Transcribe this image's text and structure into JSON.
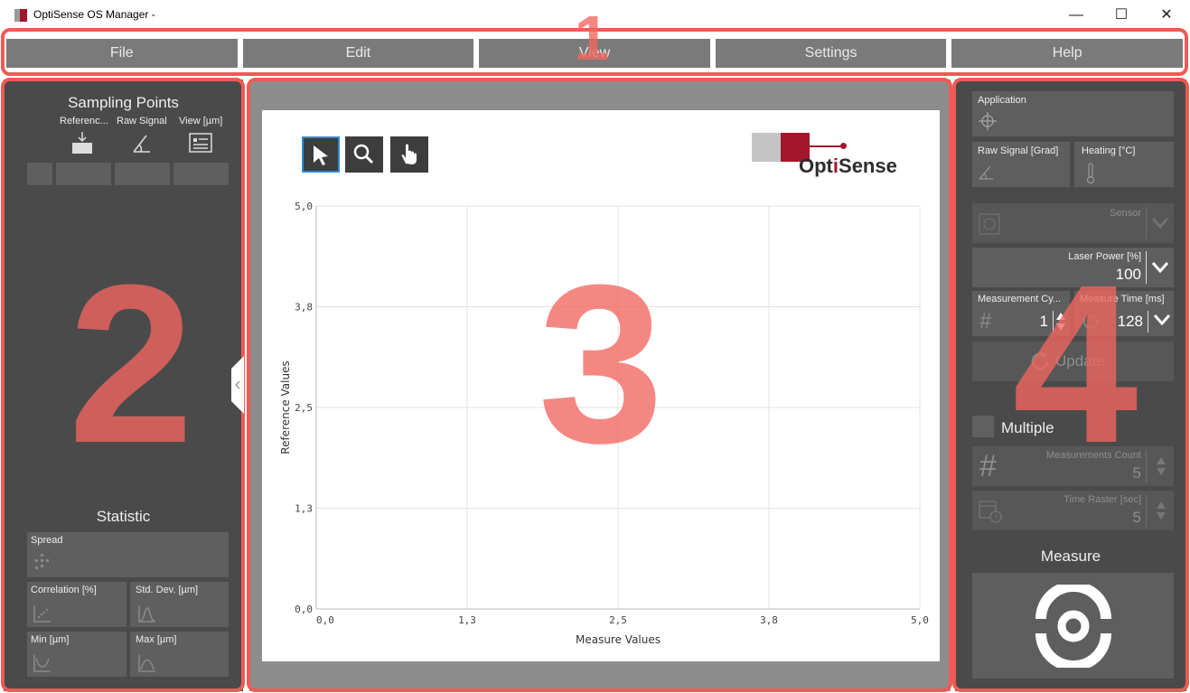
{
  "window": {
    "title": "OptiSense OS Manager -",
    "minimize": "—",
    "maximize": "☐",
    "close": "✕"
  },
  "menu": [
    "File",
    "Edit",
    "View",
    "Settings",
    "Help"
  ],
  "left": {
    "title": "Sampling Points",
    "col_reference": "Referenc...",
    "col_raw": "Raw Signal",
    "col_view": "View [µm]",
    "statistic_title": "Statistic",
    "spread": "Spread",
    "correlation": "Correlation [%]",
    "std_dev": "Std. Dev. [µm]",
    "min": "Min [µm]",
    "max": "Max [µm]"
  },
  "brand": {
    "name_opt": "Opt",
    "name_i": "i",
    "name_sense": "Sense"
  },
  "chart_data": {
    "type": "scatter",
    "xlabel": "Measure Values",
    "ylabel": "Reference Values",
    "xlim": [
      0,
      5
    ],
    "ylim": [
      0,
      5
    ],
    "x_ticks": [
      "0,0",
      "1,3",
      "2,5",
      "3,8",
      "5,0"
    ],
    "y_ticks": [
      "0,0",
      "1,3",
      "2,5",
      "3,8",
      "5,0"
    ],
    "grid": true,
    "points": []
  },
  "right": {
    "application": "Application",
    "raw_signal": "Raw Signal [Grad]",
    "heating": "Heating [°C]",
    "sensor": "Sensor",
    "laser_power_label": "Laser Power [%]",
    "laser_power_value": "100",
    "meas_cycles_label": "Measurement Cy...",
    "meas_cycles_value": "1",
    "meas_time_label": "Measure Time [ms]",
    "meas_time_value": "128",
    "update": "Update",
    "multiple": "Multiple",
    "meas_count_label": "Measurements Count",
    "meas_count_value": "5",
    "time_raster_label": "Time Raster [sec]",
    "time_raster_value": "5",
    "measure": "Measure"
  },
  "overlay_numbers": [
    "1",
    "2",
    "3",
    "4"
  ],
  "colors": {
    "accent": "#a3162c",
    "frame": "#f05a55",
    "panel": "#4a4a4a"
  }
}
